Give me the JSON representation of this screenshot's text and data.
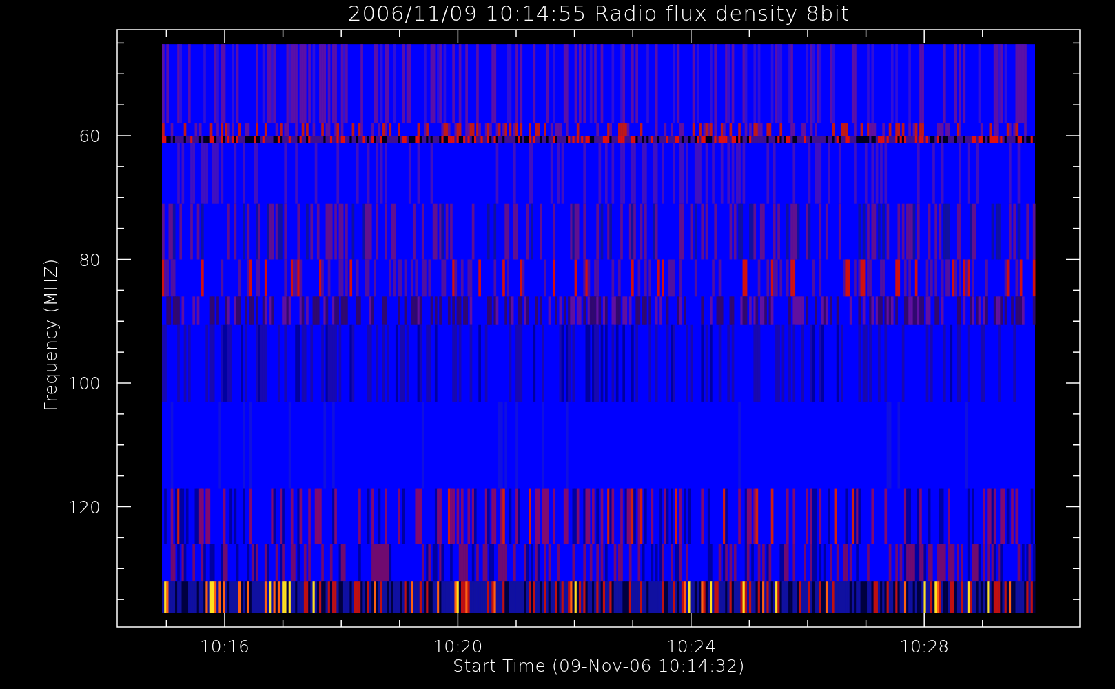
{
  "title": "2006/11/09 10:14:55 Radio flux density 8bit",
  "y_axis": {
    "label": "Frequency (MHZ)",
    "ticks": [
      "60",
      "80",
      "100",
      "120"
    ]
  },
  "x_axis": {
    "label": "Start Time (09-Nov-06 10:14:32)",
    "ticks": [
      "10:16",
      "10:20",
      "10:24",
      "10:28"
    ]
  }
}
